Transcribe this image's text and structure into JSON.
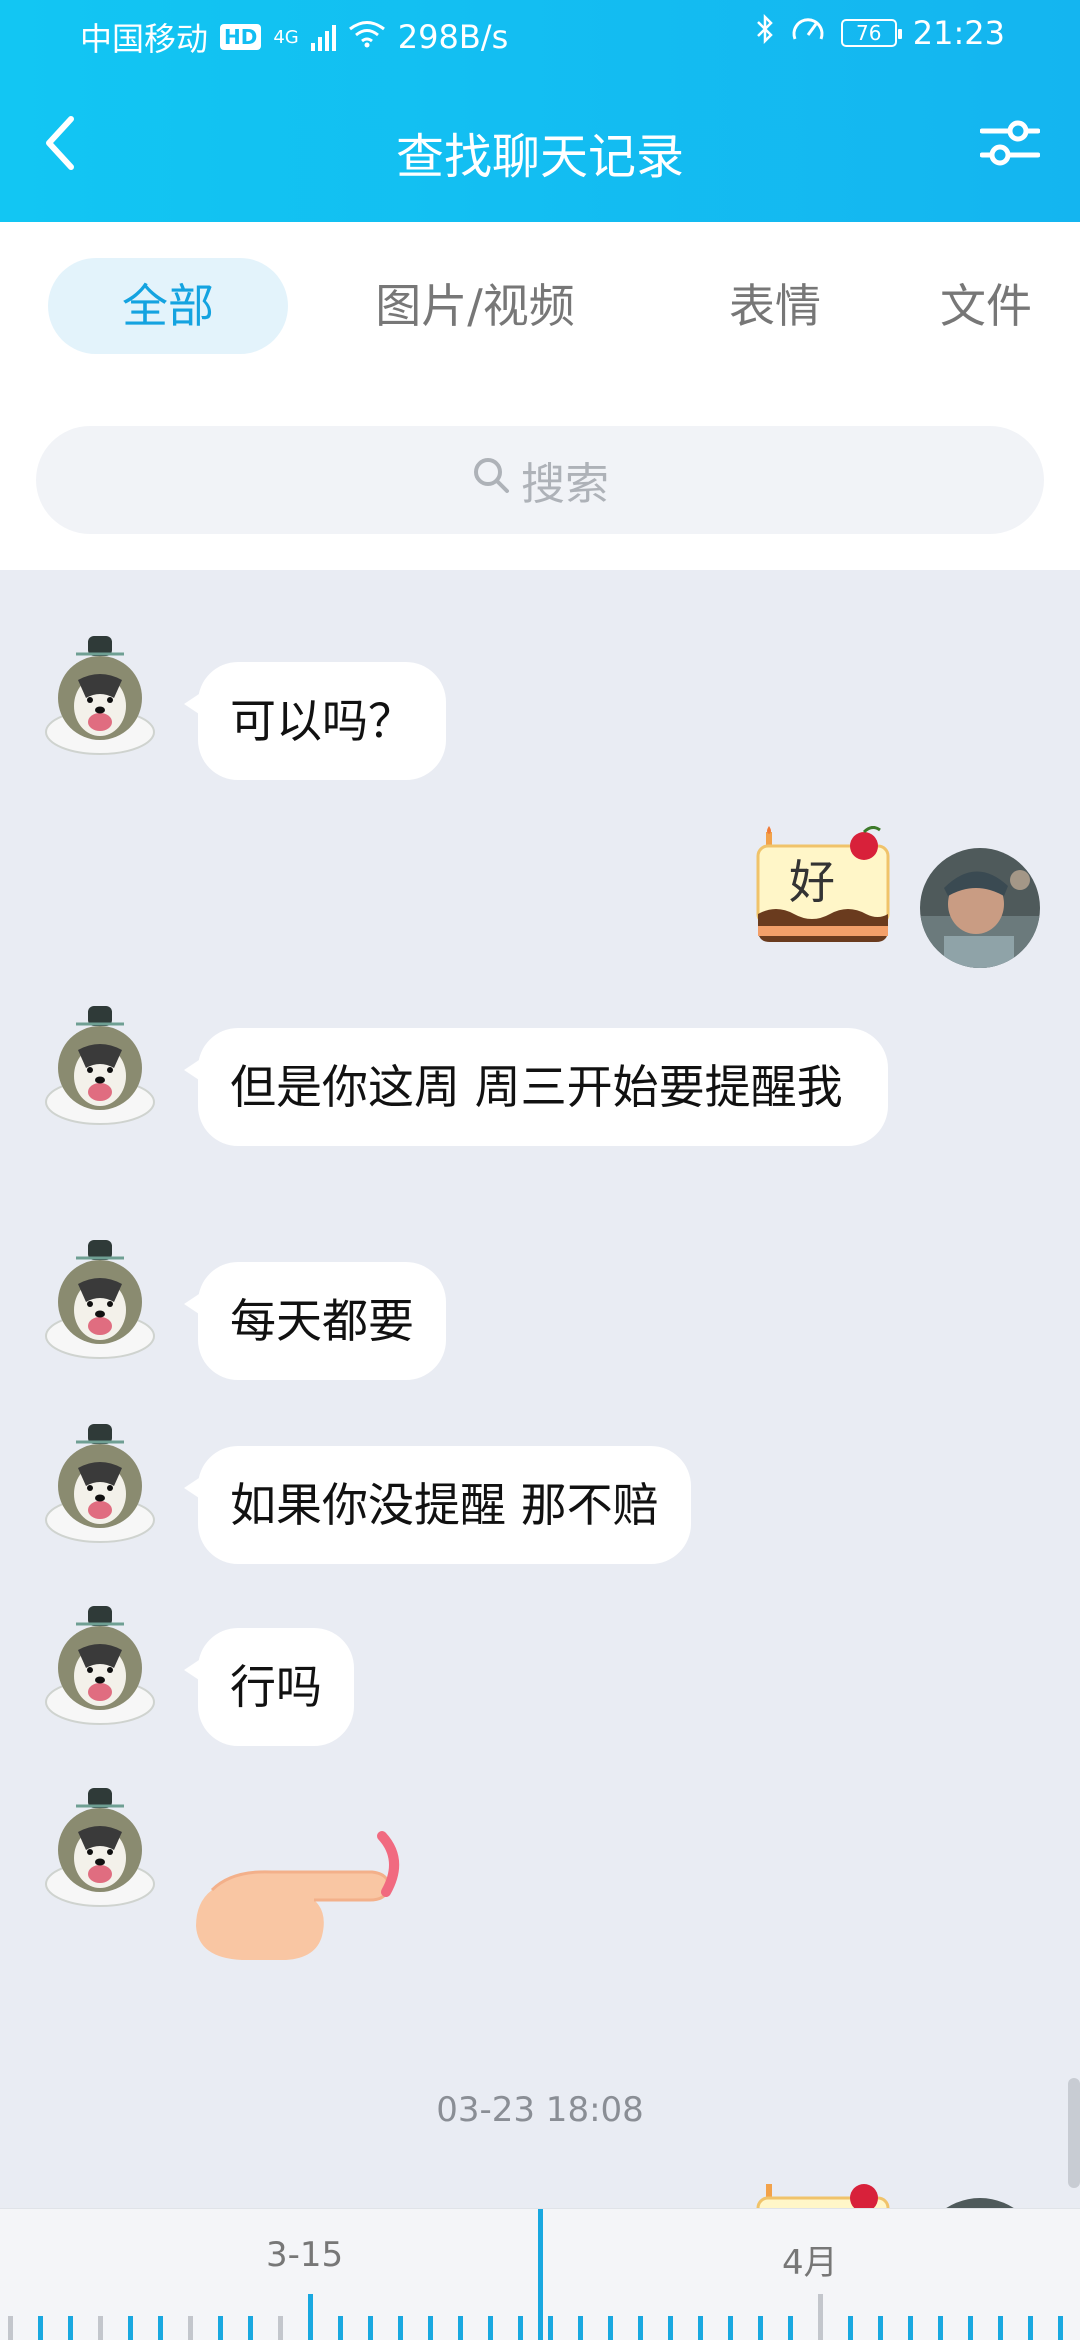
{
  "status_bar": {
    "carrier": "中国移动",
    "hd": "HD",
    "network": "4G",
    "speed": "298B/s",
    "battery": "76",
    "time": "21:23"
  },
  "title_bar": {
    "title": "查找聊天记录",
    "back_icon": "chevron-left-icon",
    "filter_icon": "sliders-icon"
  },
  "tabs": [
    {
      "label": "全部",
      "active": true
    },
    {
      "label": "图片/视频",
      "active": false
    },
    {
      "label": "表情",
      "active": false
    },
    {
      "label": "文件",
      "active": false
    }
  ],
  "search": {
    "placeholder": "搜索"
  },
  "messages": [
    {
      "side": "left",
      "text": "可以吗？"
    },
    {
      "side": "right",
      "sticker": "cake-sticker",
      "text": "好"
    },
    {
      "side": "left",
      "text": "但是你这周 周三开始要提醒我"
    },
    {
      "side": "left",
      "text": "每天都要"
    },
    {
      "side": "left",
      "text": "如果你没提醒 那不赔"
    },
    {
      "side": "left",
      "text": "行吗"
    },
    {
      "side": "left",
      "sticker": "pointing-hand-sticker"
    }
  ],
  "timestamp": "03-23 18:08",
  "timeline": {
    "labels": [
      "3-15",
      "4月"
    ]
  },
  "colors": {
    "header_blue": "#14b5f0",
    "accent": "#14a3e0",
    "chat_bg": "#e9ecf3"
  }
}
